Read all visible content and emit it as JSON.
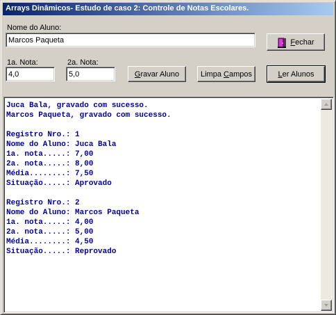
{
  "window": {
    "title": "Arrays Dinâmicos- Estudo de caso 2: Controle de Notas Escolares."
  },
  "form": {
    "nome_label": "Nome do Aluno:",
    "nome_value": "Marcos Paqueta",
    "nota1_label": "1a. Nota:",
    "nota1_value": "4,0",
    "nota2_label": "2a. Nota:",
    "nota2_value": "5,0"
  },
  "buttons": {
    "fechar_hotkey": "F",
    "fechar_rest": "echar",
    "gravar_hotkey": "G",
    "gravar_rest": "ravar Aluno",
    "limpa_pre": "Limpa ",
    "limpa_hotkey": "C",
    "limpa_rest": "ampos",
    "ler_hotkey": "L",
    "ler_rest": "er Alunos"
  },
  "icons": {
    "fechar": "door-exit-icon"
  },
  "colors": {
    "memo_text": "#0000a0",
    "title_start": "#0a246a",
    "title_end": "#a6caf0"
  },
  "output": {
    "lines": [
      "Juca Bala, gravado com sucesso.",
      "Marcos Paqueta, gravado com sucesso.",
      "",
      "Registro Nro.: 1",
      "Nome do Aluno: Juca Bala",
      "1a. nota.....: 7,00",
      "2a. nota.....: 8,00",
      "Média........: 7,50",
      "Situação.....: Aprovado",
      "",
      "Registro Nro.: 2",
      "Nome do Aluno: Marcos Paqueta",
      "1a. nota.....: 4,00",
      "2a. nota.....: 5,00",
      "Média........: 4,50",
      "Situação.....: Reprovado"
    ]
  }
}
